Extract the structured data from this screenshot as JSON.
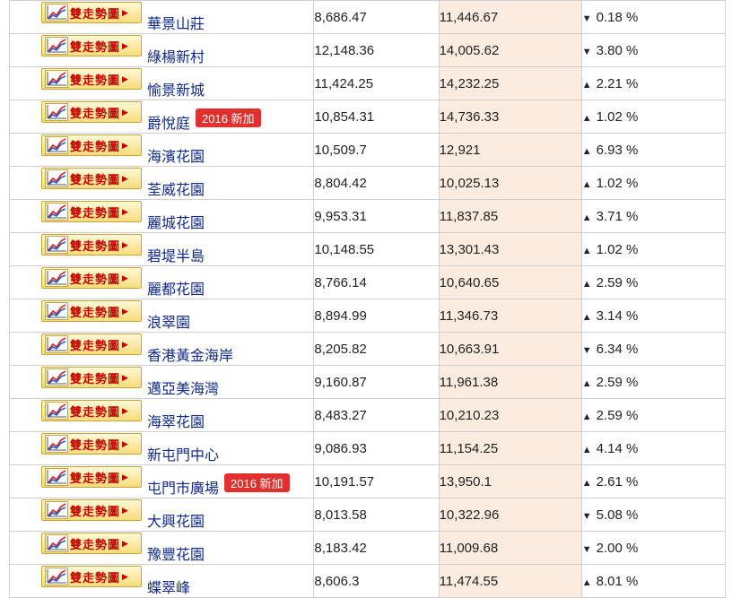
{
  "button_label": "雙走勢圖",
  "badge_label": "2016 新加",
  "colors": {
    "up": "#1a2fbf",
    "down": "#d10000",
    "badge": "#e0312f",
    "highlight_column": "#fcece0"
  },
  "rows": [
    {
      "name": "華景山莊",
      "price_a": "8,686.47",
      "price_b": "11,446.67",
      "change": "0.18 %",
      "direction": "down",
      "new": false
    },
    {
      "name": "綠楊新村",
      "price_a": "12,148.36",
      "price_b": "14,005.62",
      "change": "3.80 %",
      "direction": "down",
      "new": false
    },
    {
      "name": "愉景新城",
      "price_a": "11,424.25",
      "price_b": "14,232.25",
      "change": "2.21 %",
      "direction": "up",
      "new": false
    },
    {
      "name": "爵悅庭",
      "price_a": "10,854.31",
      "price_b": "14,736.33",
      "change": "1.02 %",
      "direction": "up",
      "new": true
    },
    {
      "name": "海濱花園",
      "price_a": "10,509.7",
      "price_b": "12,921",
      "change": "6.93 %",
      "direction": "up",
      "new": false
    },
    {
      "name": "荃威花園",
      "price_a": "8,804.42",
      "price_b": "10,025.13",
      "change": "1.02 %",
      "direction": "up",
      "new": false
    },
    {
      "name": "麗城花園",
      "price_a": "9,953.31",
      "price_b": "11,837.85",
      "change": "3.71 %",
      "direction": "up",
      "new": false
    },
    {
      "name": "碧堤半島",
      "price_a": "10,148.55",
      "price_b": "13,301.43",
      "change": "1.02 %",
      "direction": "up",
      "new": false
    },
    {
      "name": "麗都花園",
      "price_a": "8,766.14",
      "price_b": "10,640.65",
      "change": "2.59 %",
      "direction": "up",
      "new": false
    },
    {
      "name": "浪翠園",
      "price_a": "8,894.99",
      "price_b": "11,346.73",
      "change": "3.14 %",
      "direction": "up",
      "new": false
    },
    {
      "name": "香港黃金海岸",
      "price_a": "8,205.82",
      "price_b": "10,663.91",
      "change": "6.34 %",
      "direction": "down",
      "new": false
    },
    {
      "name": "邁亞美海灣",
      "price_a": "9,160.87",
      "price_b": "11,961.38",
      "change": "2.59 %",
      "direction": "up",
      "new": false
    },
    {
      "name": "海翠花園",
      "price_a": "8,483.27",
      "price_b": "10,210.23",
      "change": "2.59 %",
      "direction": "up",
      "new": false
    },
    {
      "name": "新屯門中心",
      "price_a": "9,086.93",
      "price_b": "11,154.25",
      "change": "4.14 %",
      "direction": "up",
      "new": false
    },
    {
      "name": "屯門市廣場",
      "price_a": "10,191.57",
      "price_b": "13,950.1",
      "change": "2.61 %",
      "direction": "up",
      "new": true
    },
    {
      "name": "大興花園",
      "price_a": "8,013.58",
      "price_b": "10,322.96",
      "change": "5.08 %",
      "direction": "down",
      "new": false
    },
    {
      "name": "豫豐花園",
      "price_a": "8,183.42",
      "price_b": "11,009.68",
      "change": "2.00 %",
      "direction": "down",
      "new": false
    },
    {
      "name": "蝶翠峰",
      "price_a": "8,606.3",
      "price_b": "11,474.55",
      "change": "8.01 %",
      "direction": "up",
      "new": false
    }
  ]
}
